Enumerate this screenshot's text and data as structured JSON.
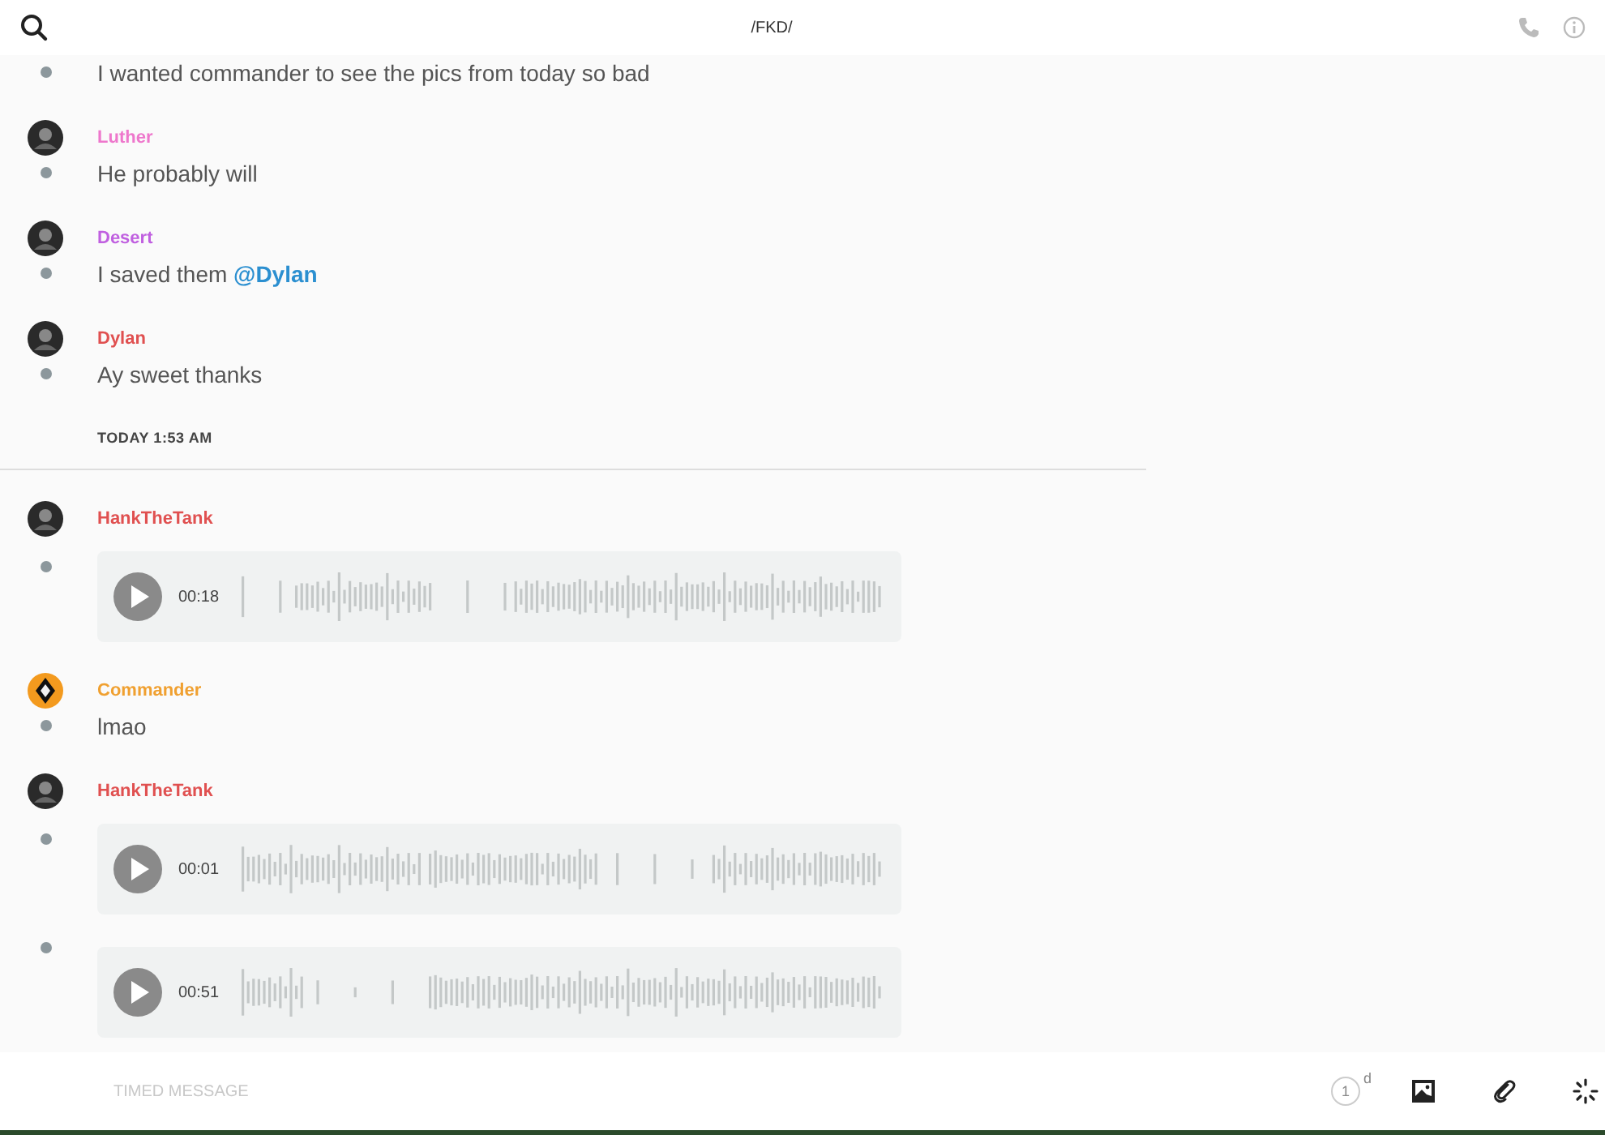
{
  "top_bar": {
    "title": "/FKD/"
  },
  "messages": [
    {
      "kind": "text",
      "text": "I wanted commander to see the pics from today so bad"
    },
    {
      "author": {
        "name": "Luther",
        "color": "#ee77cc",
        "kind": "photo"
      },
      "kind": "text",
      "text": "He probably will"
    },
    {
      "author": {
        "name": "Desert",
        "color": "#c060e0",
        "kind": "photo"
      },
      "kind": "text",
      "text": "I saved them **@Dylan**"
    },
    {
      "author": {
        "name": "Dylan",
        "color": "#e05050",
        "kind": "photo"
      },
      "kind": "text",
      "text": "Ay sweet thanks"
    },
    {
      "kind": "separator",
      "text": "TODAY 1:53 AM"
    },
    {
      "author": {
        "name": "HankTheTank",
        "color": "#e05050",
        "kind": "photo"
      },
      "kind": "audio",
      "duration": "00:18"
    },
    {
      "author": {
        "name": "Commander",
        "color": "#f0a030",
        "kind": "emblem"
      },
      "kind": "text",
      "text": "lmao"
    },
    {
      "author": {
        "name": "HankTheTank",
        "color": "#e05050",
        "kind": "photo"
      },
      "kind": "audio",
      "duration": "00:01"
    },
    {
      "kind": "audio",
      "duration": "00:51"
    }
  ],
  "composer": {
    "placeholder": "TIMED MESSAGE",
    "timer": "1",
    "timer_unit": "d"
  }
}
